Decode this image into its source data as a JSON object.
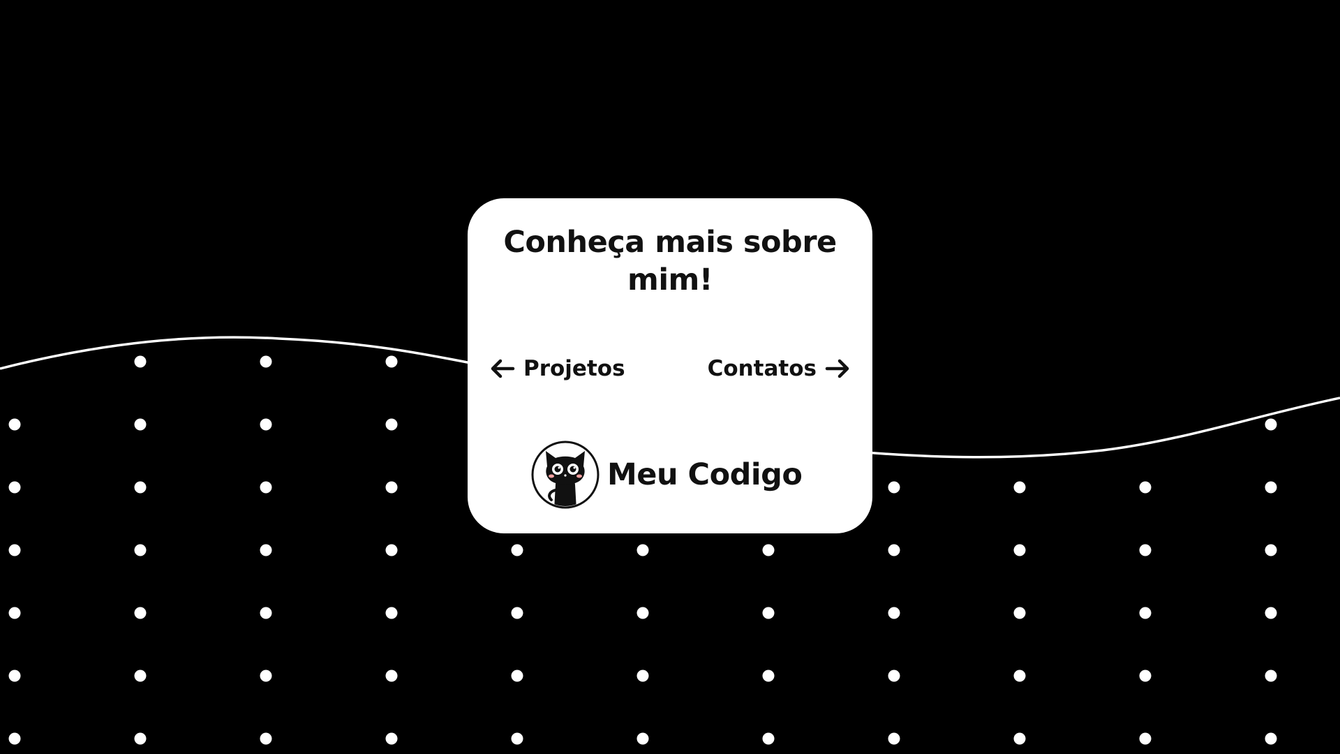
{
  "card": {
    "title": "Conheça mais sobre mim!",
    "nav_left": {
      "label": "Projetos",
      "icon": "arrow-left-icon"
    },
    "nav_right": {
      "label": "Contatos",
      "icon": "arrow-right-icon"
    },
    "brand": {
      "label": "Meu Codigo",
      "icon": "github-octocat-icon"
    }
  },
  "colors": {
    "background": "#000000",
    "card": "#ffffff",
    "text": "#111111",
    "dots": "#ffffff",
    "wave": "#ffffff"
  }
}
